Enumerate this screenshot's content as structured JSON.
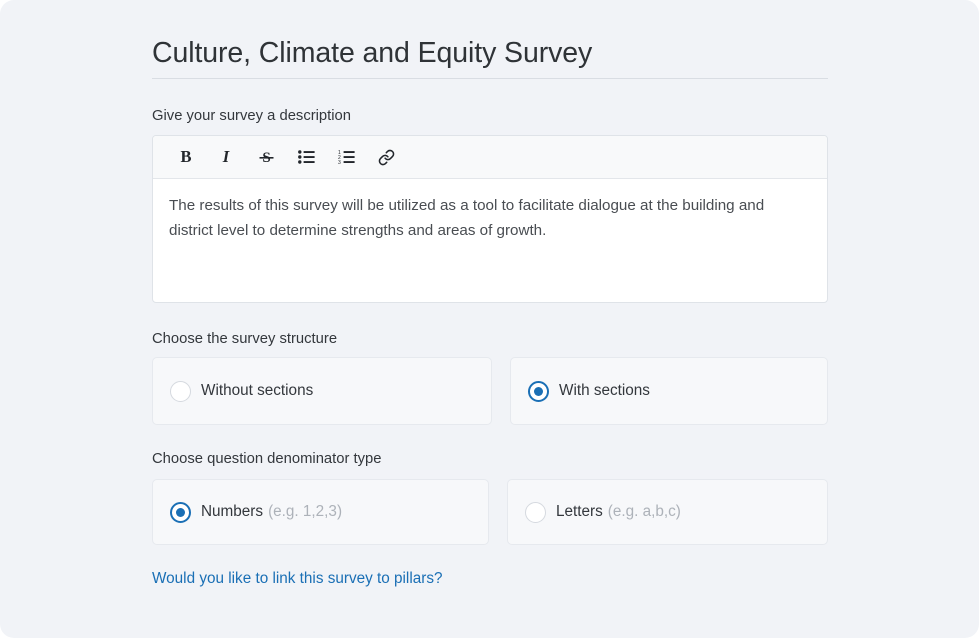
{
  "page": {
    "background_color": "#f1f3f7",
    "accent_color": "#1a6fb5"
  },
  "survey": {
    "title": "Culture, Climate and Equity Survey"
  },
  "description": {
    "label": "Give your survey a description",
    "toolbar": [
      {
        "name": "bold",
        "glyph": "B",
        "title": "Bold"
      },
      {
        "name": "italic",
        "glyph": "I",
        "title": "Italic"
      },
      {
        "name": "strikethrough",
        "glyph": "S",
        "title": "Strikethrough"
      },
      {
        "name": "bullet-list",
        "glyph": "☰",
        "title": "Bulleted list"
      },
      {
        "name": "numbered-list",
        "glyph": "☰",
        "title": "Numbered list"
      },
      {
        "name": "link",
        "glyph": "🔗",
        "title": "Insert link"
      }
    ],
    "body_text": "The results of this survey will be utilized as a tool to facilitate dialogue at the building and district level to determine strengths and areas of growth."
  },
  "structure": {
    "label": "Choose the survey structure",
    "options": [
      {
        "label": "Without sections",
        "selected": false
      },
      {
        "label": "With sections",
        "selected": true
      }
    ]
  },
  "denominator": {
    "label": "Choose question denominator type",
    "options": [
      {
        "label": "Numbers",
        "hint": "(e.g. 1,2,3)",
        "selected": true
      },
      {
        "label": "Letters",
        "hint": "(e.g. a,b,c)",
        "selected": false
      }
    ]
  },
  "footer": {
    "pillars_link": "Would you like to link this survey to pillars?"
  }
}
